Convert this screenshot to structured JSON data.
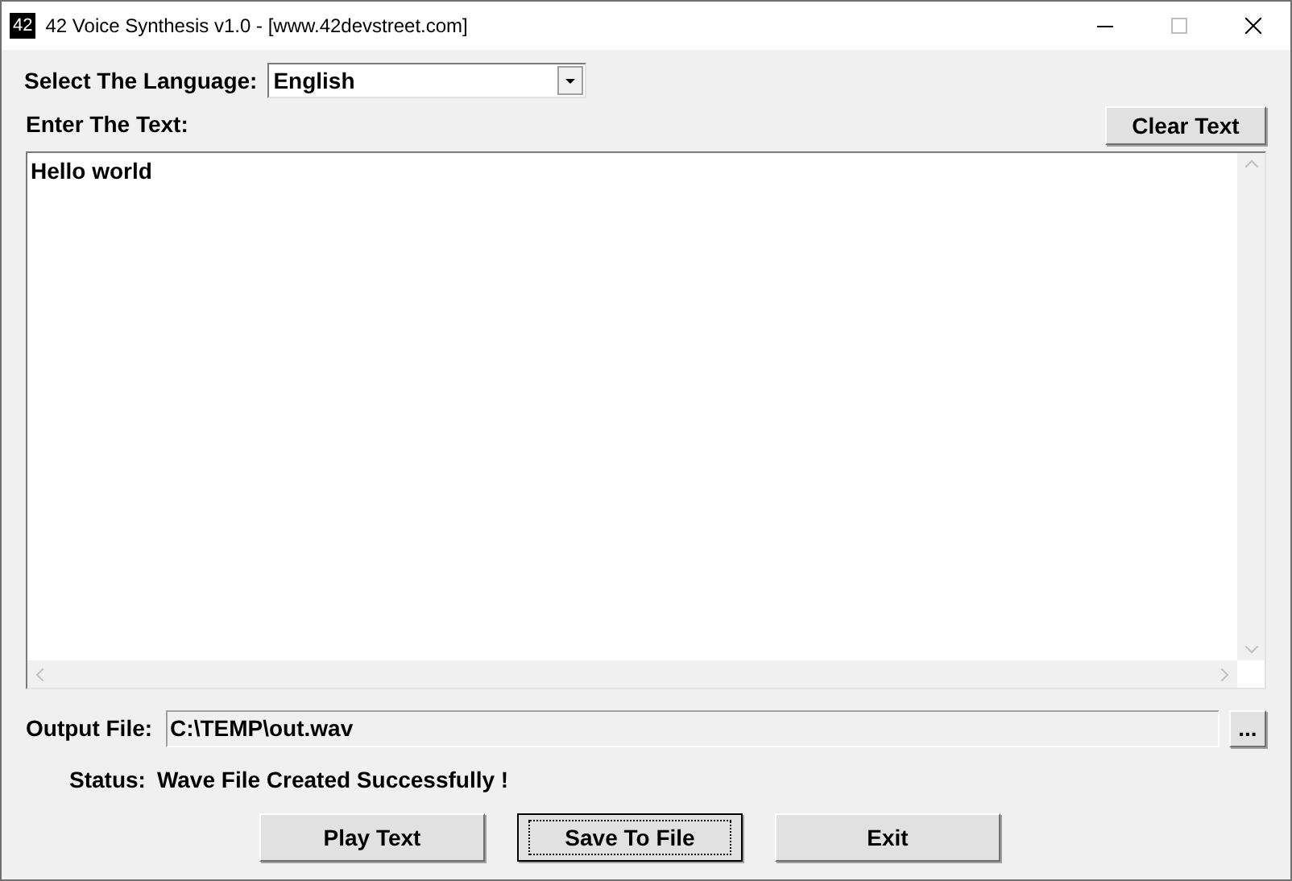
{
  "window": {
    "icon_text": "42",
    "title": "42 Voice Synthesis v1.0 - [www.42devstreet.com]"
  },
  "language": {
    "label": "Select The Language:",
    "value": "English"
  },
  "text_input": {
    "label": "Enter The Text:",
    "value": "Hello world"
  },
  "clear_button": "Clear Text",
  "output_file": {
    "label": "Output File:",
    "value": "C:\\TEMP\\out.wav",
    "browse": "..."
  },
  "status": {
    "label": "Status:",
    "value": "Wave File Created Successfully !"
  },
  "buttons": [
    {
      "label": "Play Text",
      "focused": false
    },
    {
      "label": "Save To File",
      "focused": true
    },
    {
      "label": "Exit",
      "focused": false
    }
  ]
}
